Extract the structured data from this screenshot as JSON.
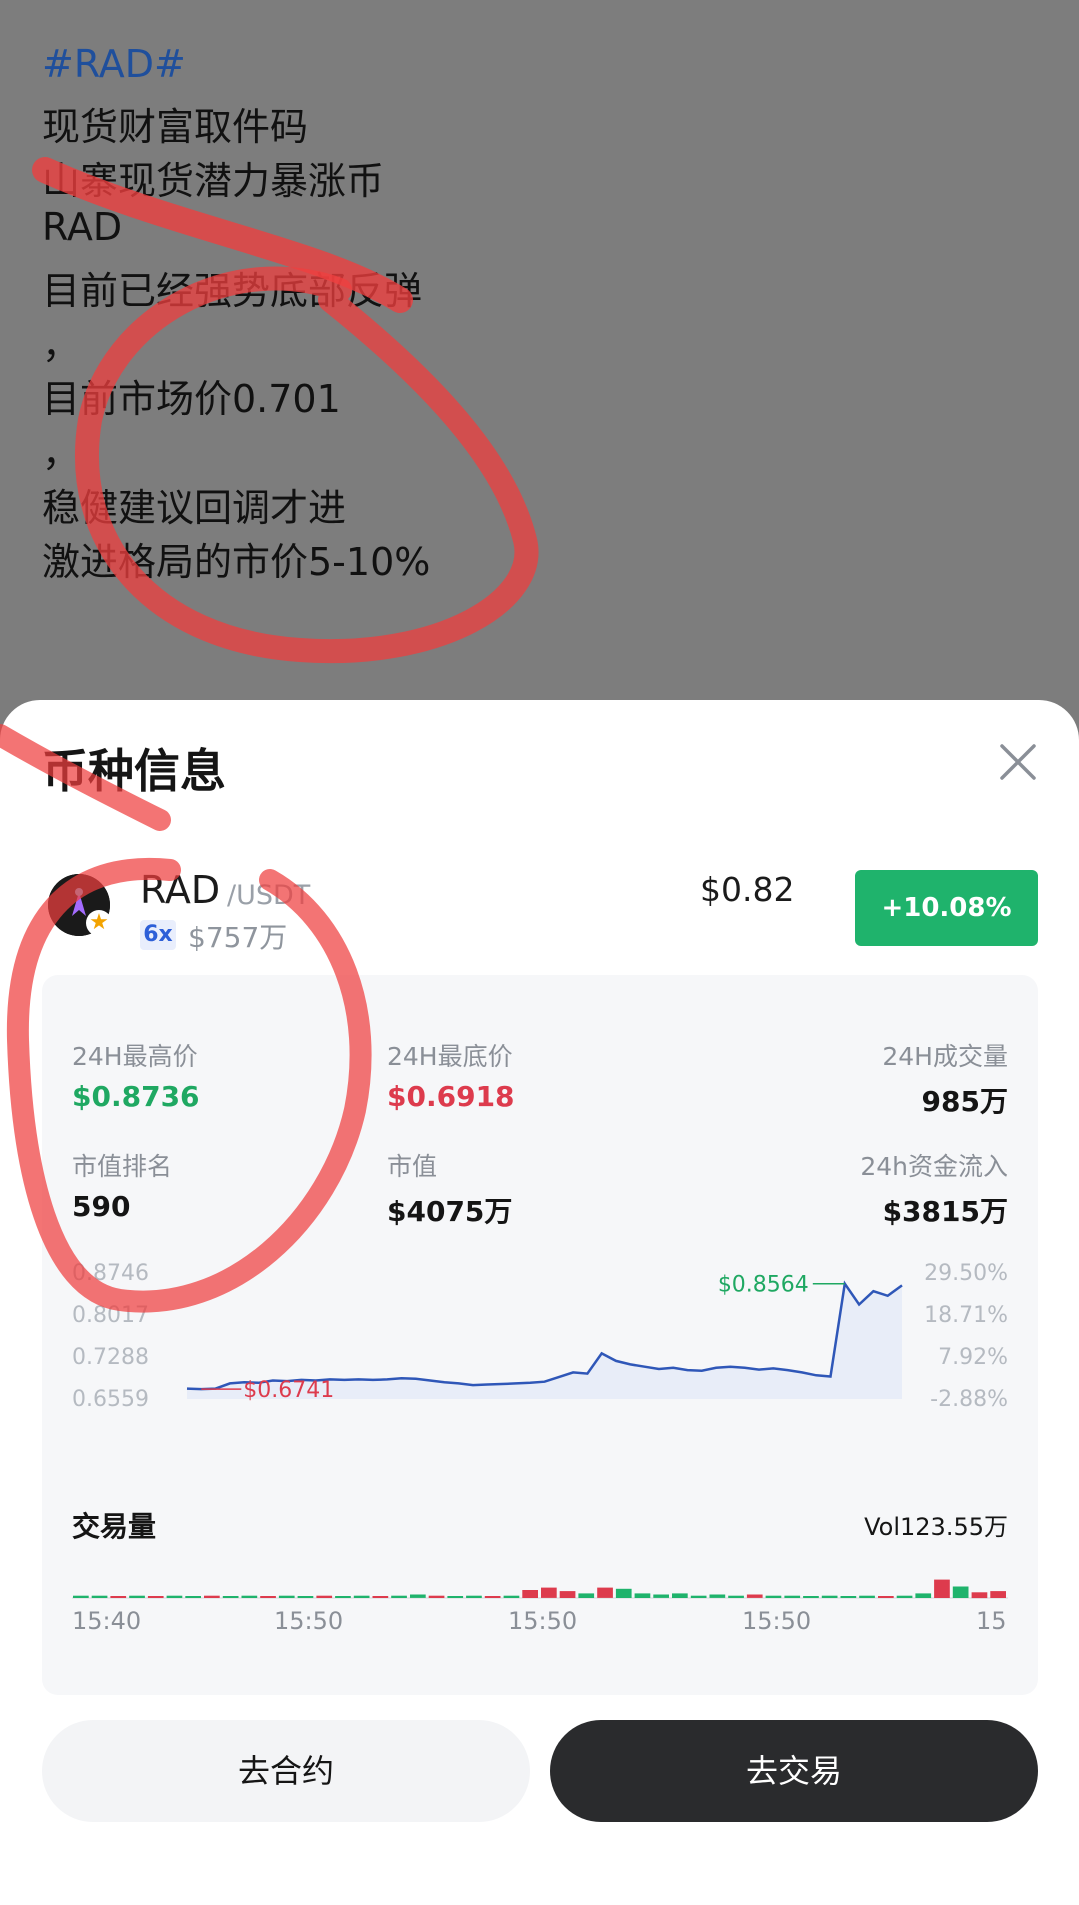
{
  "post": {
    "lines": [
      "#RAD#",
      "现货财富取件码",
      "山寨现货潜力暴涨币",
      "RAD",
      "目前已经强势底部反弹",
      "，",
      "目前市场价0.701",
      "，",
      "稳健建议回调才进",
      "激进格局的市价5-10%"
    ]
  },
  "sheet": {
    "title": "币种信息",
    "close_icon": "close-icon"
  },
  "coin": {
    "symbol": "RAD",
    "quote": "/USDT",
    "leverage": "6x",
    "volume": "$757万",
    "price": "$0.82",
    "change": "+10.08%",
    "change_color": "#1fb36c"
  },
  "stats": {
    "high_label": "24H最高价",
    "high_value": "$0.8736",
    "low_label": "24H最底价",
    "low_value": "$0.6918",
    "volume_label": "24H成交量",
    "volume_value": "985万",
    "rank_label": "市值排名",
    "rank_value": "590",
    "mcap_label": "市值",
    "mcap_value": "$4075万",
    "inflow_label": "24h资金流入",
    "inflow_value": "$3815万"
  },
  "chart_data": {
    "type": "line",
    "y_left_ticks": [
      "0.8746",
      "0.8017",
      "0.7288",
      "0.6559"
    ],
    "y_right_ticks": [
      "29.50%",
      "18.71%",
      "7.92%",
      "-2.88%"
    ],
    "ylim": [
      0.6559,
      0.8746
    ],
    "annotations": {
      "max_label": "$0.8564",
      "min_label": "$0.6741"
    },
    "x_ticks": [
      "15:40",
      "15:50",
      "15:50",
      "15:50",
      "15:"
    ],
    "price": [
      0.674,
      0.673,
      0.674,
      0.683,
      0.685,
      0.684,
      0.688,
      0.687,
      0.689,
      0.688,
      0.69,
      0.689,
      0.69,
      0.689,
      0.69,
      0.692,
      0.691,
      0.688,
      0.685,
      0.683,
      0.68,
      0.681,
      0.682,
      0.683,
      0.684,
      0.686,
      0.694,
      0.702,
      0.7,
      0.735,
      0.722,
      0.716,
      0.712,
      0.708,
      0.71,
      0.706,
      0.705,
      0.71,
      0.712,
      0.71,
      0.707,
      0.709,
      0.706,
      0.702,
      0.697,
      0.695,
      0.856,
      0.82,
      0.843,
      0.835,
      0.853
    ],
    "volume_title": "交易量",
    "volume_total": "Vol123.55万",
    "volume": [
      {
        "v": 0.1,
        "c": "g"
      },
      {
        "v": 0.1,
        "c": "g"
      },
      {
        "v": 0.05,
        "c": "r"
      },
      {
        "v": 0.1,
        "c": "g"
      },
      {
        "v": 0.05,
        "c": "r"
      },
      {
        "v": 0.1,
        "c": "g"
      },
      {
        "v": 0.05,
        "c": "g"
      },
      {
        "v": 0.1,
        "c": "r"
      },
      {
        "v": 0.05,
        "c": "g"
      },
      {
        "v": 0.1,
        "c": "g"
      },
      {
        "v": 0.05,
        "c": "r"
      },
      {
        "v": 0.1,
        "c": "g"
      },
      {
        "v": 0.05,
        "c": "g"
      },
      {
        "v": 0.1,
        "c": "r"
      },
      {
        "v": 0.05,
        "c": "g"
      },
      {
        "v": 0.1,
        "c": "g"
      },
      {
        "v": 0.05,
        "c": "r"
      },
      {
        "v": 0.1,
        "c": "g"
      },
      {
        "v": 0.15,
        "c": "g"
      },
      {
        "v": 0.1,
        "c": "r"
      },
      {
        "v": 0.05,
        "c": "g"
      },
      {
        "v": 0.1,
        "c": "g"
      },
      {
        "v": 0.05,
        "c": "r"
      },
      {
        "v": 0.1,
        "c": "g"
      },
      {
        "v": 0.35,
        "c": "r"
      },
      {
        "v": 0.45,
        "c": "r"
      },
      {
        "v": 0.3,
        "c": "r"
      },
      {
        "v": 0.2,
        "c": "g"
      },
      {
        "v": 0.45,
        "c": "r"
      },
      {
        "v": 0.4,
        "c": "g"
      },
      {
        "v": 0.2,
        "c": "g"
      },
      {
        "v": 0.15,
        "c": "g"
      },
      {
        "v": 0.2,
        "c": "g"
      },
      {
        "v": 0.1,
        "c": "g"
      },
      {
        "v": 0.15,
        "c": "g"
      },
      {
        "v": 0.1,
        "c": "g"
      },
      {
        "v": 0.15,
        "c": "r"
      },
      {
        "v": 0.1,
        "c": "g"
      },
      {
        "v": 0.1,
        "c": "g"
      },
      {
        "v": 0.05,
        "c": "g"
      },
      {
        "v": 0.1,
        "c": "g"
      },
      {
        "v": 0.05,
        "c": "g"
      },
      {
        "v": 0.1,
        "c": "g"
      },
      {
        "v": 0.05,
        "c": "r"
      },
      {
        "v": 0.1,
        "c": "g"
      },
      {
        "v": 0.2,
        "c": "g"
      },
      {
        "v": 0.8,
        "c": "r"
      },
      {
        "v": 0.5,
        "c": "g"
      },
      {
        "v": 0.25,
        "c": "r"
      },
      {
        "v": 0.3,
        "c": "r"
      }
    ]
  },
  "actions": {
    "contract_label": "去合约",
    "trade_label": "去交易"
  }
}
